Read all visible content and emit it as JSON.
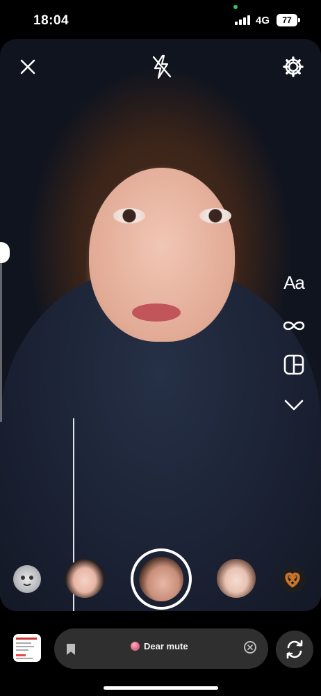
{
  "status_bar": {
    "time": "18:04",
    "network": "4G",
    "battery": "77"
  },
  "top_controls": {
    "close_icon": "close-icon",
    "flash_icon": "flash-off-icon",
    "settings_icon": "gear-icon"
  },
  "side_tools": {
    "create_label": "Aa",
    "items": [
      "text-mode",
      "boomerang-icon",
      "layout-icon",
      "chevron-down-icon"
    ]
  },
  "effects": {
    "items": [
      "effect-sticker",
      "effect-face-filter-1",
      "effect-face-filter-2",
      "effect-pretzel"
    ]
  },
  "bottom_bar": {
    "music_label": "Dear mute",
    "gallery_icon": "gallery-thumbnail",
    "flip_icon": "flip-camera-icon"
  },
  "colors": {
    "accent_green": "#34c759",
    "pill_bg": "#2f2f2f"
  }
}
